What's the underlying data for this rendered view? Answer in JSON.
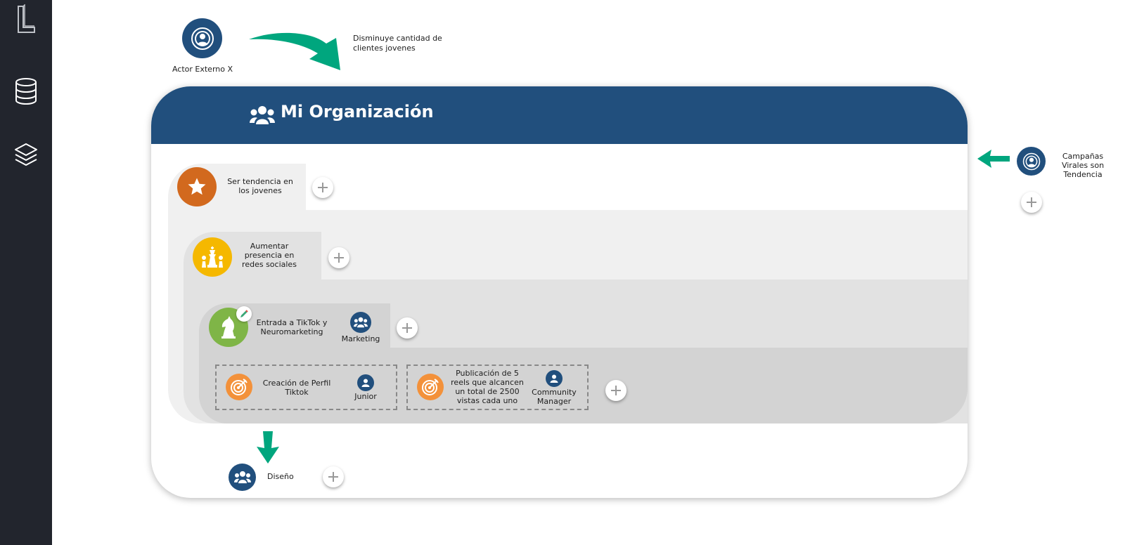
{
  "actor_top": {
    "label": "Actor Externo X",
    "message": "Disminuye cantidad de clientes jovenes"
  },
  "actor_right": {
    "label": "Campañas Virales son Tendencia"
  },
  "organization": {
    "title": "Mi Organización"
  },
  "objective_1": {
    "label": "Ser tendencia en los jovenes"
  },
  "objective_2": {
    "label": "Aumentar presencia en redes sociales"
  },
  "objective_3": {
    "label": "Entrada a TikTok y Neuromarketing",
    "team": "Marketing"
  },
  "activities": [
    {
      "label": "Creación de Perfil Tiktok",
      "role": "Junior"
    },
    {
      "label": "Publicación de 5 reels que alcancen un total de 2500 vistas cada uno",
      "role": "Community Manager"
    }
  ],
  "team_bottom": {
    "label": "Diseño"
  },
  "colors": {
    "sidebar": "#22252d",
    "navy": "#214f7d",
    "teal_arrow": "#00a67e",
    "star_orange": "#d2691e",
    "chess_yellow": "#f5b800",
    "knight_green": "#7fb547",
    "target_orange": "#f3913a"
  }
}
